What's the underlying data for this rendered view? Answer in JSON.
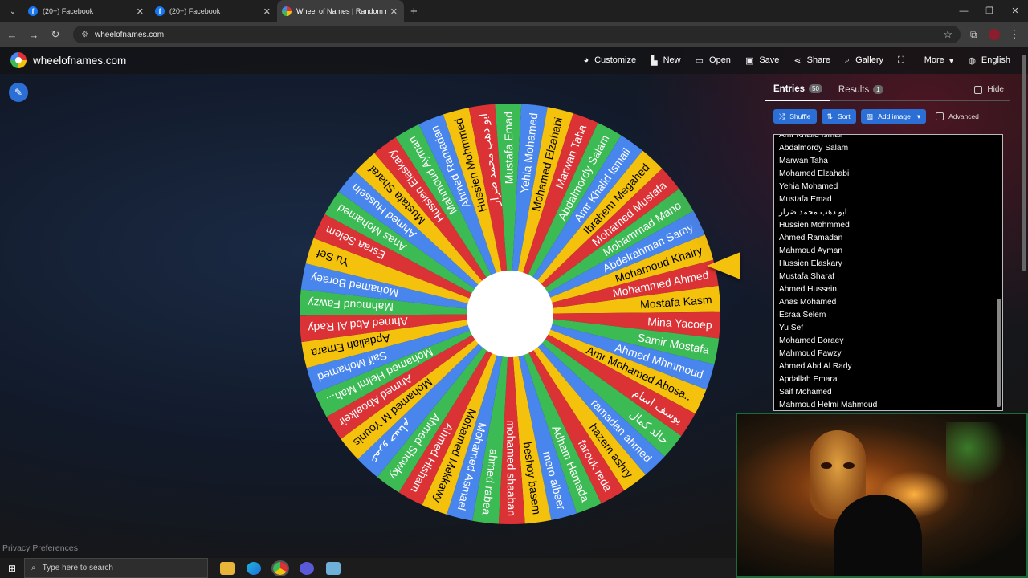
{
  "browser": {
    "tabs": [
      {
        "title": "(20+) Facebook",
        "favicon": "facebook-icon"
      },
      {
        "title": "(20+) Facebook",
        "favicon": "facebook-icon"
      },
      {
        "title": "Wheel of Names | Random nam",
        "favicon": "wheel-icon",
        "active": true
      }
    ],
    "url": "wheelofnames.com"
  },
  "site": {
    "logo_text": "wheelofnames.com",
    "menu": [
      {
        "label": "Customize",
        "icon": "palette-icon"
      },
      {
        "label": "New",
        "icon": "file-icon"
      },
      {
        "label": "Open",
        "icon": "folder-icon"
      },
      {
        "label": "Save",
        "icon": "save-icon"
      },
      {
        "label": "Share",
        "icon": "share-icon"
      },
      {
        "label": "Gallery",
        "icon": "search-icon"
      },
      {
        "label": "",
        "icon": "fullscreen-icon"
      },
      {
        "label": "More",
        "icon": "chevron-down-icon"
      },
      {
        "label": "English",
        "icon": "globe-icon"
      }
    ]
  },
  "panel": {
    "entries_tab": "Entries",
    "entries_count": "50",
    "results_tab": "Results",
    "results_count": "1",
    "hide_label": "Hide",
    "shuffle_label": "Shuffle",
    "sort_label": "Sort",
    "add_image_label": "Add image",
    "advanced_label": "Advanced",
    "entries_cut": "Amr Khalid Ismail",
    "entries": [
      "Abdalmordy Salam",
      "Marwan Taha",
      "Mohamed Elzahabi",
      "Yehia Mohamed",
      "Mustafa Emad",
      "ابو دهب محمد ضرار",
      "Hussien Mohmmed",
      "Ahmed Ramadan",
      "Mahmoud Ayman",
      "Hussien Elaskary",
      "Mustafa Sharaf",
      "Ahmed Hussein",
      "Anas Mohamed",
      "Esraa Selem",
      "Yu Sef",
      "Mohamed Boraey",
      "Mahmoud Fawzy",
      "Ahmed Abd Al Rady",
      "Apdallah Emara",
      "Saif Mohamed",
      "Mahmoud Helmi Mahmoud"
    ]
  },
  "wheel": {
    "colors": [
      "#3cba54",
      "#f4c20d",
      "#db3236",
      "#4885ed"
    ],
    "pointer_color": "#f4c20d",
    "segments": [
      "Mostafa Kasm",
      "Mina Yacoep",
      "Samir Mostafa",
      "Ahmed Mhmmoud",
      "Amr Mohamed Abosa...",
      "يوسف اسام",
      "خالد كمال",
      "ramadan ahmed",
      "hazem ashry",
      "farouk reda",
      "Adham Hamada",
      "mero albeer",
      "beshoy basem",
      "mohamed shaaban",
      "ahmed rabea",
      "Mohamed Asmael",
      "Mohamed Mekkawy",
      "Ahmed Hisham",
      "Ahmed Showky",
      "عمرو حسام",
      "Mohamed M Younis",
      "Ahmed Aboalkeir",
      "Mohamed Helmi Mah...",
      "Saif Mohamed",
      "Apdallah Emara",
      "Ahmed Abd Al Rady",
      "Mahmoud Fawzy",
      "Mohamed Boraey",
      "Yu Sef",
      "Esraa Selem",
      "Anas Mohamed",
      "Ahmed Hussein",
      "Mustafa Sharaf",
      "Hussien Elaskary",
      "Mahmoud Ayman",
      "Ahmed Ramadan",
      "Hussien Mohmmed",
      "ابو دهب محمد ضرار",
      "Mustafa Emad",
      "Yehia Mohamed",
      "Mohamed Elzahabi",
      "Marwan Taha",
      "Abdalmordy Salam",
      "Amr Khalid Ismail",
      "Ibrahem Megahed",
      "Mohamed Mustafa",
      "Mohammad Mano",
      "Abdelrahman Samy",
      "Mohamoud Khairy",
      "Mohammed Ahmed"
    ]
  },
  "footer": {
    "privacy": "Privacy Preferences"
  },
  "taskbar": {
    "search_placeholder": "Type here to search"
  }
}
